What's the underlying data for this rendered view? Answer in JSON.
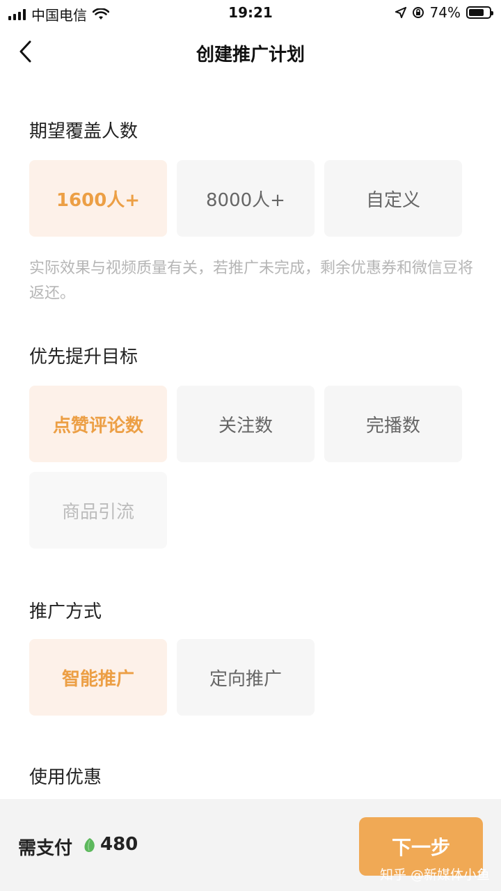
{
  "status_bar": {
    "carrier": "中国电信",
    "time": "19:21",
    "battery_text": "74%",
    "battery_level": 0.74
  },
  "nav": {
    "back_icon": "chevron-left-icon",
    "title": "创建推广计划"
  },
  "coverage": {
    "title": "期望覆盖人数",
    "options": [
      {
        "label": "1600人+",
        "state": "selected"
      },
      {
        "label": "8000人+",
        "state": "normal"
      },
      {
        "label": "自定义",
        "state": "normal"
      }
    ],
    "note": "实际效果与视频质量有关，若推广未完成，剩余优惠券和微信豆将返还。"
  },
  "goal": {
    "title": "优先提升目标",
    "options": [
      {
        "label": "点赞评论数",
        "state": "selected"
      },
      {
        "label": "关注数",
        "state": "normal"
      },
      {
        "label": "完播数",
        "state": "normal"
      },
      {
        "label": "商品引流",
        "state": "disabled"
      }
    ]
  },
  "method": {
    "title": "推广方式",
    "options": [
      {
        "label": "智能推广",
        "state": "selected"
      },
      {
        "label": "定向推广",
        "state": "normal"
      }
    ]
  },
  "discount": {
    "title": "使用优惠"
  },
  "footer": {
    "pay_label": "需支付",
    "bean_icon": "bean-icon",
    "amount": "480",
    "next_label": "下一步",
    "watermark": "知乎 @新媒体小鱼"
  },
  "colors": {
    "accent": "#ec9f45",
    "selected_bg": "#fdf1e9",
    "button": "#f0a955",
    "bean": "#5cb85c"
  }
}
